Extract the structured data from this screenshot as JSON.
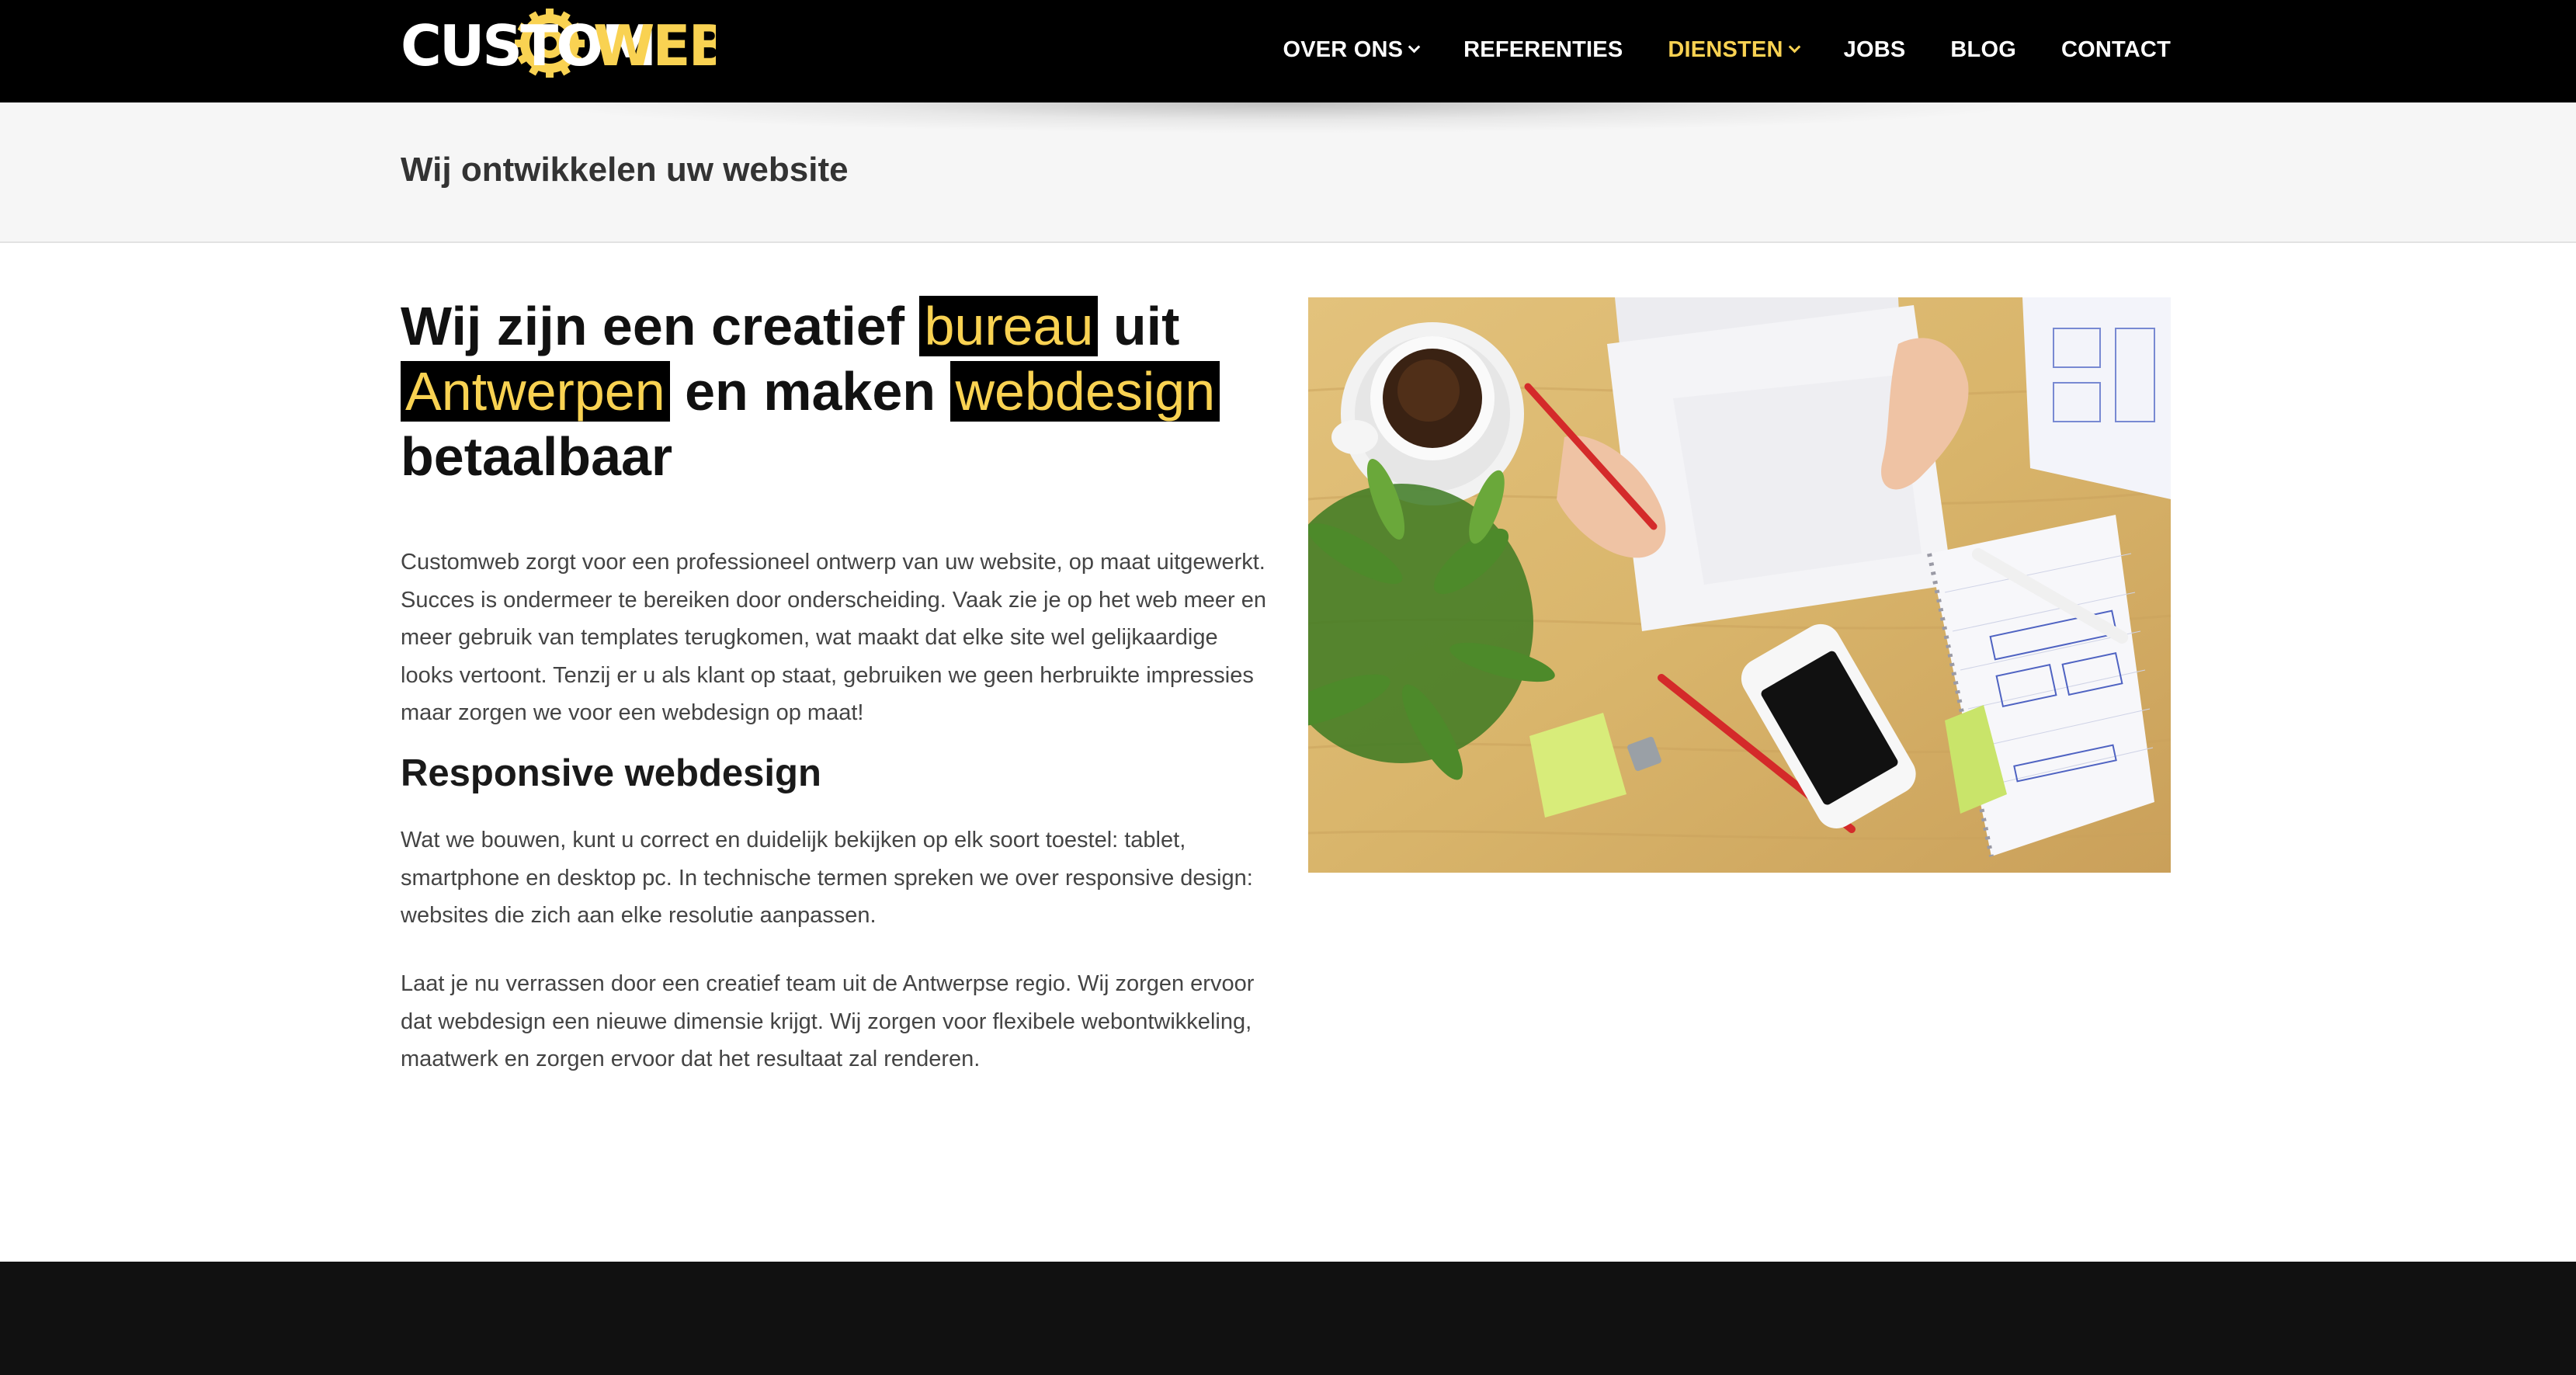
{
  "header": {
    "logo": {
      "text_custom": "CUSTOM",
      "text_web": "WEB",
      "alt": "Customweb"
    },
    "nav": [
      {
        "label": "OVER ONS",
        "has_dropdown": true,
        "active": false
      },
      {
        "label": "REFERENTIES",
        "has_dropdown": false,
        "active": false
      },
      {
        "label": "DIENSTEN",
        "has_dropdown": true,
        "active": true
      },
      {
        "label": "JOBS",
        "has_dropdown": false,
        "active": false
      },
      {
        "label": "BLOG",
        "has_dropdown": false,
        "active": false
      },
      {
        "label": "CONTACT",
        "has_dropdown": false,
        "active": false
      }
    ]
  },
  "title_bar": {
    "title": "Wij ontwikkelen uw website"
  },
  "main": {
    "headline": {
      "part1": "Wij zijn een creatief ",
      "hl1": "bureau",
      "part2": " uit ",
      "hl2": "Antwerpen",
      "part3": " en maken ",
      "hl3": "webdesign",
      "part4": " betaalbaar"
    },
    "paragraph1": "Customweb zorgt voor een professioneel ontwerp van uw website, op maat uitgewerkt. Succes is ondermeer te bereiken door onderscheiding. Vaak zie je op het web meer en meer gebruik van templates terugkomen, wat maakt dat elke site wel gelijkaardige looks vertoont. Tenzij er u als klant op staat, gebruiken we geen herbruikte impressies maar zorgen we voor een webdesign op maat!",
    "subheading": "Responsive webdesign",
    "paragraph2": "Wat we bouwen, kunt u correct en duidelijk bekijken op elk soort toestel: tablet, smartphone en desktop pc. In technische termen spreken we over responsive design: websites die zich aan elke resolutie aanpassen.",
    "paragraph3": "Laat je nu verrassen door een creatief team uit de Antwerpse regio. Wij zorgen ervoor dat webdesign een nieuwe dimensie krijgt. Wij zorgen voor flexibele webontwikkeling, maatwerk en zorgen ervoor dat het resultaat zal renderen."
  },
  "colors": {
    "accent": "#f9d252",
    "header_bg": "#000000",
    "title_bar_bg": "#f6f6f6",
    "footer_bg": "#111111"
  }
}
